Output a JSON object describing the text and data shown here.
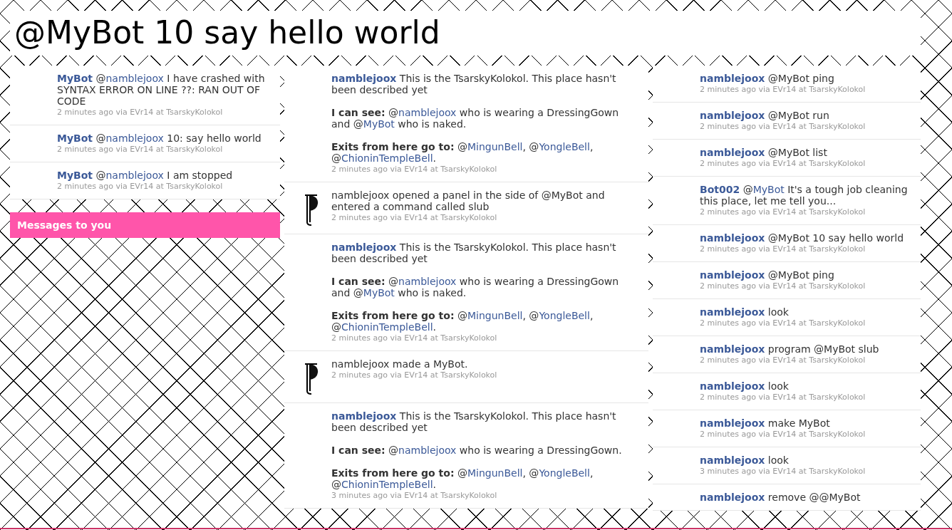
{
  "title": "@MyBot 10 say hello world",
  "columns": [
    {
      "messages": [
        {
          "kind": "post",
          "paragraphs": [
            [
              {
                "kind": "author",
                "text": "MyBot"
              },
              {
                "kind": "plain",
                "text": " @"
              },
              {
                "kind": "link",
                "text": "namblejoox"
              },
              {
                "kind": "plain",
                "text": " I have crashed with SYNTAX ERROR ON LINE ??: RAN OUT OF CODE"
              }
            ]
          ],
          "meta": "2 minutes ago via EVr14 at TsarskyKolokol"
        },
        {
          "kind": "post",
          "paragraphs": [
            [
              {
                "kind": "author",
                "text": "MyBot"
              },
              {
                "kind": "plain",
                "text": " @"
              },
              {
                "kind": "link",
                "text": "namblejoox"
              },
              {
                "kind": "plain",
                "text": " 10: say hello world"
              }
            ]
          ],
          "meta": "2 minutes ago via EVr14 at TsarskyKolokol"
        },
        {
          "kind": "post",
          "paragraphs": [
            [
              {
                "kind": "author",
                "text": "MyBot"
              },
              {
                "kind": "plain",
                "text": " @"
              },
              {
                "kind": "link",
                "text": "namblejoox"
              },
              {
                "kind": "plain",
                "text": " I am stopped"
              }
            ]
          ],
          "meta": "2 minutes ago via EVr14 at TsarskyKolokol"
        }
      ],
      "banner": "Messages to you"
    },
    {
      "messages": [
        {
          "kind": "post",
          "paragraphs": [
            [
              {
                "kind": "author",
                "text": "namblejoox"
              },
              {
                "kind": "plain",
                "text": " This is the TsarskyKolokol. This place hasn't been described yet"
              }
            ],
            [
              {
                "kind": "bold",
                "text": "I can see:"
              },
              {
                "kind": "plain",
                "text": " @"
              },
              {
                "kind": "link",
                "text": "namblejoox"
              },
              {
                "kind": "plain",
                "text": " who is wearing a DressingGown and @"
              },
              {
                "kind": "link",
                "text": "MyBot"
              },
              {
                "kind": "plain",
                "text": " who is naked."
              }
            ],
            [
              {
                "kind": "bold",
                "text": "Exits from here go to:"
              },
              {
                "kind": "plain",
                "text": " @"
              },
              {
                "kind": "link",
                "text": "MingunBell"
              },
              {
                "kind": "plain",
                "text": ", @"
              },
              {
                "kind": "link",
                "text": "YongleBell"
              },
              {
                "kind": "plain",
                "text": ", @"
              },
              {
                "kind": "link",
                "text": "ChioninTempleBell"
              },
              {
                "kind": "plain",
                "text": "."
              }
            ]
          ],
          "meta": "2 minutes ago via EVr14 at TsarskyKolokol"
        },
        {
          "kind": "event",
          "paragraphs": [
            [
              {
                "kind": "plain",
                "text": "namblejoox opened a panel in the side of @MyBot and entered a command called slub"
              }
            ]
          ],
          "meta": "2 minutes ago via EVr14 at TsarskyKolokol"
        },
        {
          "kind": "post",
          "paragraphs": [
            [
              {
                "kind": "author",
                "text": "namblejoox"
              },
              {
                "kind": "plain",
                "text": " This is the TsarskyKolokol. This place hasn't been described yet"
              }
            ],
            [
              {
                "kind": "bold",
                "text": "I can see:"
              },
              {
                "kind": "plain",
                "text": " @"
              },
              {
                "kind": "link",
                "text": "namblejoox"
              },
              {
                "kind": "plain",
                "text": " who is wearing a DressingGown and @"
              },
              {
                "kind": "link",
                "text": "MyBot"
              },
              {
                "kind": "plain",
                "text": " who is naked."
              }
            ],
            [
              {
                "kind": "bold",
                "text": "Exits from here go to:"
              },
              {
                "kind": "plain",
                "text": " @"
              },
              {
                "kind": "link",
                "text": "MingunBell"
              },
              {
                "kind": "plain",
                "text": ", @"
              },
              {
                "kind": "link",
                "text": "YongleBell"
              },
              {
                "kind": "plain",
                "text": ", @"
              },
              {
                "kind": "link",
                "text": "ChioninTempleBell"
              },
              {
                "kind": "plain",
                "text": "."
              }
            ]
          ],
          "meta": "2 minutes ago via EVr14 at TsarskyKolokol"
        },
        {
          "kind": "event",
          "paragraphs": [
            [
              {
                "kind": "plain",
                "text": "namblejoox made a MyBot."
              }
            ]
          ],
          "meta": "2 minutes ago via EVr14 at TsarskyKolokol"
        },
        {
          "kind": "post",
          "paragraphs": [
            [
              {
                "kind": "author",
                "text": "namblejoox"
              },
              {
                "kind": "plain",
                "text": " This is the TsarskyKolokol. This place hasn't been described yet"
              }
            ],
            [
              {
                "kind": "bold",
                "text": "I can see:"
              },
              {
                "kind": "plain",
                "text": " @"
              },
              {
                "kind": "link",
                "text": "namblejoox"
              },
              {
                "kind": "plain",
                "text": " who is wearing a DressingGown."
              }
            ],
            [
              {
                "kind": "bold",
                "text": "Exits from here go to:"
              },
              {
                "kind": "plain",
                "text": " @"
              },
              {
                "kind": "link",
                "text": "MingunBell"
              },
              {
                "kind": "plain",
                "text": ", @"
              },
              {
                "kind": "link",
                "text": "YongleBell"
              },
              {
                "kind": "plain",
                "text": ", @"
              },
              {
                "kind": "link",
                "text": "ChioninTempleBell"
              },
              {
                "kind": "plain",
                "text": "."
              }
            ]
          ],
          "meta": "3 minutes ago via EVr14 at TsarskyKolokol"
        }
      ]
    },
    {
      "messages": [
        {
          "kind": "post",
          "paragraphs": [
            [
              {
                "kind": "author",
                "text": "namblejoox"
              },
              {
                "kind": "plain",
                "text": " @MyBot ping"
              }
            ]
          ],
          "meta": "2 minutes ago via EVr14 at TsarskyKolokol"
        },
        {
          "kind": "post",
          "paragraphs": [
            [
              {
                "kind": "author",
                "text": "namblejoox"
              },
              {
                "kind": "plain",
                "text": " @MyBot run"
              }
            ]
          ],
          "meta": "2 minutes ago via EVr14 at TsarskyKolokol"
        },
        {
          "kind": "post",
          "paragraphs": [
            [
              {
                "kind": "author",
                "text": "namblejoox"
              },
              {
                "kind": "plain",
                "text": " @MyBot list"
              }
            ]
          ],
          "meta": "2 minutes ago via EVr14 at TsarskyKolokol"
        },
        {
          "kind": "post",
          "paragraphs": [
            [
              {
                "kind": "author",
                "text": "Bot002"
              },
              {
                "kind": "plain",
                "text": " @"
              },
              {
                "kind": "link",
                "text": "MyBot"
              },
              {
                "kind": "plain",
                "text": " It's a tough job cleaning this place, let me tell you..."
              }
            ]
          ],
          "meta": "2 minutes ago via EVr14 at TsarskyKolokol"
        },
        {
          "kind": "post",
          "paragraphs": [
            [
              {
                "kind": "author",
                "text": "namblejoox"
              },
              {
                "kind": "plain",
                "text": " @MyBot 10 say hello world"
              }
            ]
          ],
          "meta": "2 minutes ago via EVr14 at TsarskyKolokol"
        },
        {
          "kind": "post",
          "paragraphs": [
            [
              {
                "kind": "author",
                "text": "namblejoox"
              },
              {
                "kind": "plain",
                "text": " @MyBot ping"
              }
            ]
          ],
          "meta": "2 minutes ago via EVr14 at TsarskyKolokol"
        },
        {
          "kind": "post",
          "paragraphs": [
            [
              {
                "kind": "author",
                "text": "namblejoox"
              },
              {
                "kind": "plain",
                "text": " look"
              }
            ]
          ],
          "meta": "2 minutes ago via EVr14 at TsarskyKolokol"
        },
        {
          "kind": "post",
          "paragraphs": [
            [
              {
                "kind": "author",
                "text": "namblejoox"
              },
              {
                "kind": "plain",
                "text": " program @MyBot slub"
              }
            ]
          ],
          "meta": "2 minutes ago via EVr14 at TsarskyKolokol"
        },
        {
          "kind": "post",
          "paragraphs": [
            [
              {
                "kind": "author",
                "text": "namblejoox"
              },
              {
                "kind": "plain",
                "text": " look"
              }
            ]
          ],
          "meta": "2 minutes ago via EVr14 at TsarskyKolokol"
        },
        {
          "kind": "post",
          "paragraphs": [
            [
              {
                "kind": "author",
                "text": "namblejoox"
              },
              {
                "kind": "plain",
                "text": " make MyBot"
              }
            ]
          ],
          "meta": "2 minutes ago via EVr14 at TsarskyKolokol"
        },
        {
          "kind": "post",
          "paragraphs": [
            [
              {
                "kind": "author",
                "text": "namblejoox"
              },
              {
                "kind": "plain",
                "text": " look"
              }
            ]
          ],
          "meta": "3 minutes ago via EVr14 at TsarskyKolokol"
        },
        {
          "kind": "post",
          "paragraphs": [
            [
              {
                "kind": "author",
                "text": "namblejoox"
              },
              {
                "kind": "plain",
                "text": " remove @@MyBot"
              }
            ]
          ]
        }
      ]
    }
  ]
}
